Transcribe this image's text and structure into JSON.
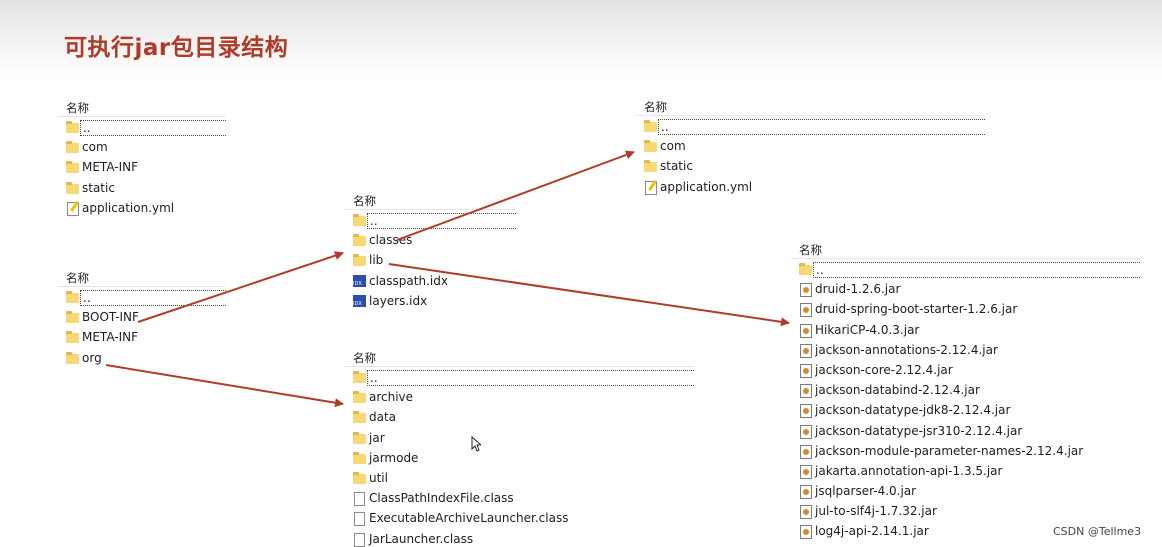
{
  "slide": {
    "title": "可执行jar包目录结构"
  },
  "header_label": "名称",
  "panels": {
    "root_src": {
      "items": [
        {
          "name": "..",
          "icon": "folder-icon"
        },
        {
          "name": "com",
          "icon": "folder-icon"
        },
        {
          "name": "META-INF",
          "icon": "folder-icon"
        },
        {
          "name": "static",
          "icon": "folder-icon"
        },
        {
          "name": "application.yml",
          "icon": "yml-file-icon"
        }
      ]
    },
    "jar_root": {
      "items": [
        {
          "name": "..",
          "icon": "folder-icon"
        },
        {
          "name": "BOOT-INF",
          "icon": "folder-icon"
        },
        {
          "name": "META-INF",
          "icon": "folder-icon"
        },
        {
          "name": "org",
          "icon": "folder-icon"
        }
      ]
    },
    "boot_inf": {
      "items": [
        {
          "name": "..",
          "icon": "folder-icon"
        },
        {
          "name": "classes",
          "icon": "folder-icon"
        },
        {
          "name": "lib",
          "icon": "folder-icon"
        },
        {
          "name": "classpath.idx",
          "icon": "idx-file-icon"
        },
        {
          "name": "layers.idx",
          "icon": "idx-file-icon"
        }
      ]
    },
    "classes": {
      "items": [
        {
          "name": "..",
          "icon": "folder-icon"
        },
        {
          "name": "com",
          "icon": "folder-icon"
        },
        {
          "name": "static",
          "icon": "folder-icon"
        },
        {
          "name": "application.yml",
          "icon": "yml-file-icon"
        }
      ]
    },
    "org_loader": {
      "items": [
        {
          "name": "..",
          "icon": "folder-icon"
        },
        {
          "name": "archive",
          "icon": "folder-icon"
        },
        {
          "name": "data",
          "icon": "folder-icon"
        },
        {
          "name": "jar",
          "icon": "folder-icon"
        },
        {
          "name": "jarmode",
          "icon": "folder-icon"
        },
        {
          "name": "util",
          "icon": "folder-icon"
        },
        {
          "name": "ClassPathIndexFile.class",
          "icon": "class-file-icon"
        },
        {
          "name": "ExecutableArchiveLauncher.class",
          "icon": "class-file-icon"
        },
        {
          "name": "JarLauncher.class",
          "icon": "class-file-icon"
        }
      ]
    },
    "lib": {
      "items": [
        {
          "name": "..",
          "icon": "folder-icon"
        },
        {
          "name": "druid-1.2.6.jar",
          "icon": "jar-file-icon"
        },
        {
          "name": "druid-spring-boot-starter-1.2.6.jar",
          "icon": "jar-file-icon"
        },
        {
          "name": "HikariCP-4.0.3.jar",
          "icon": "jar-file-icon"
        },
        {
          "name": "jackson-annotations-2.12.4.jar",
          "icon": "jar-file-icon"
        },
        {
          "name": "jackson-core-2.12.4.jar",
          "icon": "jar-file-icon"
        },
        {
          "name": "jackson-databind-2.12.4.jar",
          "icon": "jar-file-icon"
        },
        {
          "name": "jackson-datatype-jdk8-2.12.4.jar",
          "icon": "jar-file-icon"
        },
        {
          "name": "jackson-datatype-jsr310-2.12.4.jar",
          "icon": "jar-file-icon"
        },
        {
          "name": "jackson-module-parameter-names-2.12.4.jar",
          "icon": "jar-file-icon"
        },
        {
          "name": "jakarta.annotation-api-1.3.5.jar",
          "icon": "jar-file-icon"
        },
        {
          "name": "jsqlparser-4.0.jar",
          "icon": "jar-file-icon"
        },
        {
          "name": "jul-to-slf4j-1.7.32.jar",
          "icon": "jar-file-icon"
        },
        {
          "name": "log4j-api-2.14.1.jar",
          "icon": "jar-file-icon"
        }
      ]
    }
  },
  "colors": {
    "title": "#b03a26",
    "arrow": "#b23a28",
    "folder": "#f8d775"
  },
  "watermark": "CSDN @Tellme3"
}
